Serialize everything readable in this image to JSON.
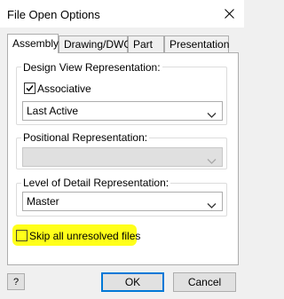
{
  "window": {
    "title": "File Open Options",
    "close_symbol": "×"
  },
  "tabs": [
    {
      "label": "Assembly",
      "active": true
    },
    {
      "label": "Drawing/DWG",
      "active": false
    },
    {
      "label": "Part",
      "active": false
    },
    {
      "label": "Presentation",
      "active": false
    }
  ],
  "design_view": {
    "group_label": "Design View Representation:",
    "associative_label": "Associative",
    "associative_checked": true,
    "selected_value": "Last Active"
  },
  "positional": {
    "group_label": "Positional Representation:",
    "selected_value": "",
    "disabled": true
  },
  "level_of_detail": {
    "group_label": "Level of Detail Representation:",
    "selected_value": "Master"
  },
  "skip_unresolved": {
    "label": "Skip all unresolved files",
    "checked": false,
    "highlight_color": "#ffff1a"
  },
  "footer": {
    "help_symbol": "?",
    "ok_label": "OK",
    "cancel_label": "Cancel"
  },
  "colors": {
    "accent": "#0078d7"
  }
}
